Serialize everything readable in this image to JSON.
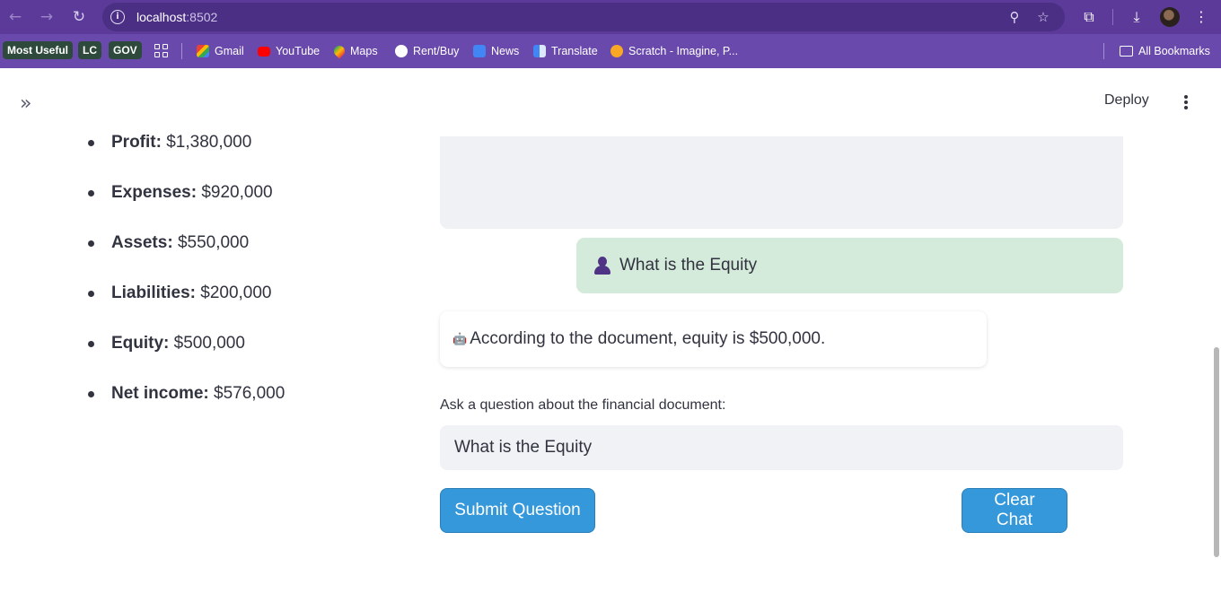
{
  "browser": {
    "url_host": "localhost",
    "url_port": ":8502",
    "icons": {
      "back": "arrow-left-icon",
      "forward": "arrow-right-icon",
      "reload": "reload-icon",
      "site_info": "info-icon",
      "zoom": "zoom-icon",
      "star": "star-icon",
      "extensions": "puzzle-icon",
      "download": "download-icon",
      "menu": "more-vert-icon"
    }
  },
  "bookmarks": {
    "items": [
      {
        "label": "Most Useful"
      },
      {
        "label": "LC"
      },
      {
        "label": "GOV"
      },
      {
        "label": "Gmail"
      },
      {
        "label": "YouTube"
      },
      {
        "label": "Maps"
      },
      {
        "label": "Rent/Buy"
      },
      {
        "label": "News"
      },
      {
        "label": "Translate"
      },
      {
        "label": "Scratch - Imagine, P..."
      }
    ],
    "all_bookmarks": "All Bookmarks"
  },
  "app": {
    "header": {
      "expand_icon": "»",
      "deploy_label": "Deploy"
    },
    "summary": [
      {
        "label": "Profit:",
        "value": "$1,380,000"
      },
      {
        "label": "Expenses:",
        "value": "$920,000"
      },
      {
        "label": "Assets:",
        "value": "$550,000"
      },
      {
        "label": "Liabilities:",
        "value": "$200,000"
      },
      {
        "label": "Equity:",
        "value": "$500,000"
      },
      {
        "label": "Net income:",
        "value": "$576,000"
      }
    ],
    "chat": {
      "user_message": "What is the Equity",
      "bot_message": "According to the document, equity is $500,000.",
      "bot_icon": "🤖"
    },
    "question": {
      "label": "Ask a question about the financial document:",
      "value": "What is the Equity"
    },
    "buttons": {
      "submit": "Submit Question",
      "clear": "Clear Chat"
    }
  }
}
